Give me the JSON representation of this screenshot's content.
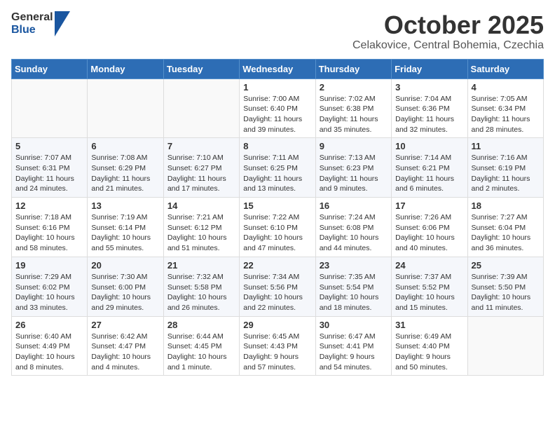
{
  "logo": {
    "general": "General",
    "blue": "Blue"
  },
  "header": {
    "month": "October 2025",
    "location": "Celakovice, Central Bohemia, Czechia"
  },
  "weekdays": [
    "Sunday",
    "Monday",
    "Tuesday",
    "Wednesday",
    "Thursday",
    "Friday",
    "Saturday"
  ],
  "weeks": [
    [
      {
        "day": "",
        "info": ""
      },
      {
        "day": "",
        "info": ""
      },
      {
        "day": "",
        "info": ""
      },
      {
        "day": "1",
        "info": "Sunrise: 7:00 AM\nSunset: 6:40 PM\nDaylight: 11 hours and 39 minutes."
      },
      {
        "day": "2",
        "info": "Sunrise: 7:02 AM\nSunset: 6:38 PM\nDaylight: 11 hours and 35 minutes."
      },
      {
        "day": "3",
        "info": "Sunrise: 7:04 AM\nSunset: 6:36 PM\nDaylight: 11 hours and 32 minutes."
      },
      {
        "day": "4",
        "info": "Sunrise: 7:05 AM\nSunset: 6:34 PM\nDaylight: 11 hours and 28 minutes."
      }
    ],
    [
      {
        "day": "5",
        "info": "Sunrise: 7:07 AM\nSunset: 6:31 PM\nDaylight: 11 hours and 24 minutes."
      },
      {
        "day": "6",
        "info": "Sunrise: 7:08 AM\nSunset: 6:29 PM\nDaylight: 11 hours and 21 minutes."
      },
      {
        "day": "7",
        "info": "Sunrise: 7:10 AM\nSunset: 6:27 PM\nDaylight: 11 hours and 17 minutes."
      },
      {
        "day": "8",
        "info": "Sunrise: 7:11 AM\nSunset: 6:25 PM\nDaylight: 11 hours and 13 minutes."
      },
      {
        "day": "9",
        "info": "Sunrise: 7:13 AM\nSunset: 6:23 PM\nDaylight: 11 hours and 9 minutes."
      },
      {
        "day": "10",
        "info": "Sunrise: 7:14 AM\nSunset: 6:21 PM\nDaylight: 11 hours and 6 minutes."
      },
      {
        "day": "11",
        "info": "Sunrise: 7:16 AM\nSunset: 6:19 PM\nDaylight: 11 hours and 2 minutes."
      }
    ],
    [
      {
        "day": "12",
        "info": "Sunrise: 7:18 AM\nSunset: 6:16 PM\nDaylight: 10 hours and 58 minutes."
      },
      {
        "day": "13",
        "info": "Sunrise: 7:19 AM\nSunset: 6:14 PM\nDaylight: 10 hours and 55 minutes."
      },
      {
        "day": "14",
        "info": "Sunrise: 7:21 AM\nSunset: 6:12 PM\nDaylight: 10 hours and 51 minutes."
      },
      {
        "day": "15",
        "info": "Sunrise: 7:22 AM\nSunset: 6:10 PM\nDaylight: 10 hours and 47 minutes."
      },
      {
        "day": "16",
        "info": "Sunrise: 7:24 AM\nSunset: 6:08 PM\nDaylight: 10 hours and 44 minutes."
      },
      {
        "day": "17",
        "info": "Sunrise: 7:26 AM\nSunset: 6:06 PM\nDaylight: 10 hours and 40 minutes."
      },
      {
        "day": "18",
        "info": "Sunrise: 7:27 AM\nSunset: 6:04 PM\nDaylight: 10 hours and 36 minutes."
      }
    ],
    [
      {
        "day": "19",
        "info": "Sunrise: 7:29 AM\nSunset: 6:02 PM\nDaylight: 10 hours and 33 minutes."
      },
      {
        "day": "20",
        "info": "Sunrise: 7:30 AM\nSunset: 6:00 PM\nDaylight: 10 hours and 29 minutes."
      },
      {
        "day": "21",
        "info": "Sunrise: 7:32 AM\nSunset: 5:58 PM\nDaylight: 10 hours and 26 minutes."
      },
      {
        "day": "22",
        "info": "Sunrise: 7:34 AM\nSunset: 5:56 PM\nDaylight: 10 hours and 22 minutes."
      },
      {
        "day": "23",
        "info": "Sunrise: 7:35 AM\nSunset: 5:54 PM\nDaylight: 10 hours and 18 minutes."
      },
      {
        "day": "24",
        "info": "Sunrise: 7:37 AM\nSunset: 5:52 PM\nDaylight: 10 hours and 15 minutes."
      },
      {
        "day": "25",
        "info": "Sunrise: 7:39 AM\nSunset: 5:50 PM\nDaylight: 10 hours and 11 minutes."
      }
    ],
    [
      {
        "day": "26",
        "info": "Sunrise: 6:40 AM\nSunset: 4:49 PM\nDaylight: 10 hours and 8 minutes."
      },
      {
        "day": "27",
        "info": "Sunrise: 6:42 AM\nSunset: 4:47 PM\nDaylight: 10 hours and 4 minutes."
      },
      {
        "day": "28",
        "info": "Sunrise: 6:44 AM\nSunset: 4:45 PM\nDaylight: 10 hours and 1 minute."
      },
      {
        "day": "29",
        "info": "Sunrise: 6:45 AM\nSunset: 4:43 PM\nDaylight: 9 hours and 57 minutes."
      },
      {
        "day": "30",
        "info": "Sunrise: 6:47 AM\nSunset: 4:41 PM\nDaylight: 9 hours and 54 minutes."
      },
      {
        "day": "31",
        "info": "Sunrise: 6:49 AM\nSunset: 4:40 PM\nDaylight: 9 hours and 50 minutes."
      },
      {
        "day": "",
        "info": ""
      }
    ]
  ]
}
